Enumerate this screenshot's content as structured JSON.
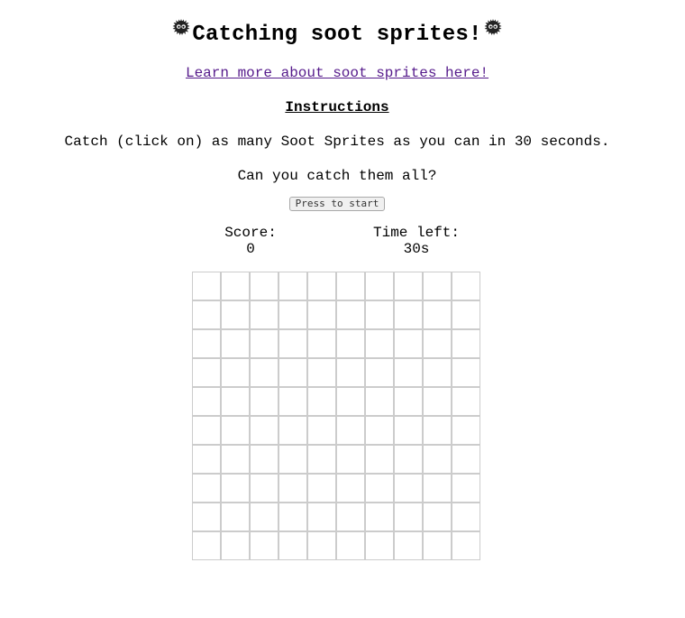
{
  "header": {
    "title": "Catching soot sprites!",
    "left_icon": "soot-sprite-icon",
    "right_icon": "soot-sprite-icon"
  },
  "learn_more": {
    "link_text": "Learn more about soot sprites here!"
  },
  "instructions": {
    "heading": "Instructions",
    "text": "Catch (click on) as many Soot Sprites as you can in 30 seconds.",
    "challenge": "Can you catch them all?"
  },
  "controls": {
    "start_label": "Press to start"
  },
  "stats": {
    "score_label": "Score:",
    "score_value": "0",
    "time_label": "Time left:",
    "time_value": "30s"
  },
  "grid": {
    "rows": 10,
    "columns": 10
  },
  "colors": {
    "link": "#551a8b",
    "grid_lines": "#cccccc",
    "sprite_body": "#222222"
  }
}
